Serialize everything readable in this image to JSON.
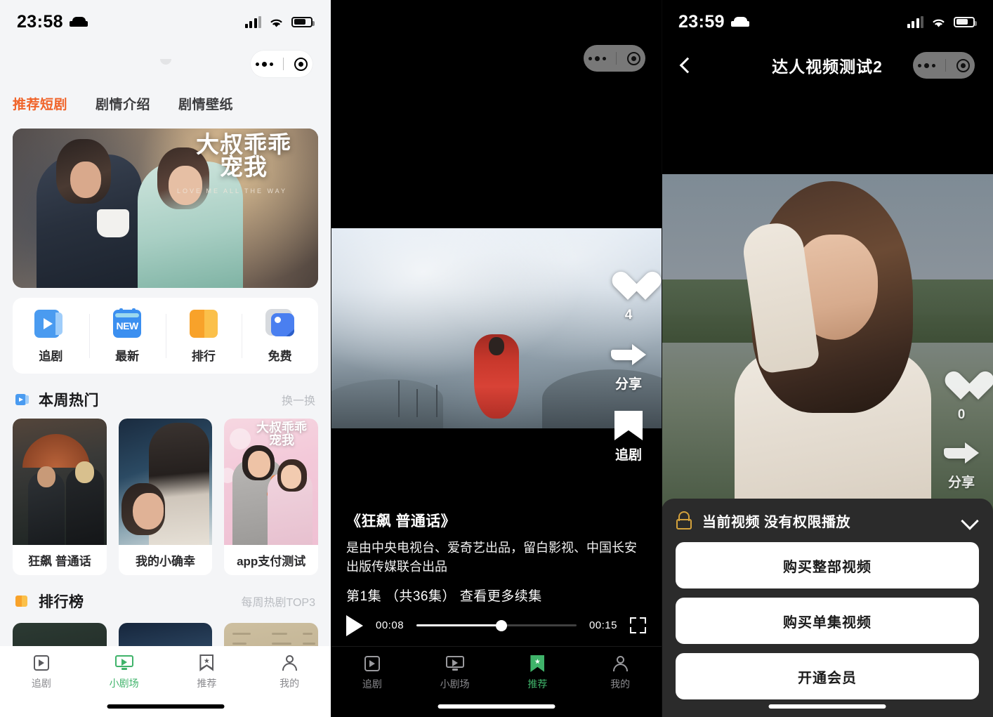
{
  "left": {
    "status": {
      "time": "23:58",
      "bed_icon": "bed-icon",
      "signal_icon": "signal-icon",
      "wifi_icon": "wifi-icon",
      "battery_icon": "battery-icon"
    },
    "capsule": {
      "more_icon": "more-dots-icon",
      "target_icon": "target-circle-icon"
    },
    "tabs": [
      {
        "label": "推荐短剧",
        "active": true
      },
      {
        "label": "剧情介绍",
        "active": false
      },
      {
        "label": "剧情壁纸",
        "active": false
      }
    ],
    "hero": {
      "title_line1": "大叔乖乖",
      "title_line2": "宠我",
      "subtitle": "LOVE ME ALL THE WAY"
    },
    "quick_actions": [
      {
        "label": "追剧",
        "icon": "play-card-icon"
      },
      {
        "label": "最新",
        "icon": "new-calendar-icon",
        "badge": "NEW"
      },
      {
        "label": "排行",
        "icon": "rank-book-icon"
      },
      {
        "label": "免费",
        "icon": "free-image-icon"
      }
    ],
    "hot_section": {
      "title": "本周热门",
      "more": "换一换",
      "icon": "blue-play-icon"
    },
    "hot_cards": [
      {
        "title": "狂飙 普通话"
      },
      {
        "title": "我的小确幸"
      },
      {
        "title": "app支付测试"
      }
    ],
    "rank_section": {
      "title": "排行榜",
      "more": "每周热剧TOP3",
      "icon": "orange-book-icon"
    },
    "tabbar": [
      {
        "label": "追剧",
        "icon": "play-square-icon",
        "active": false
      },
      {
        "label": "小剧场",
        "icon": "tv-icon",
        "active": true
      },
      {
        "label": "推荐",
        "icon": "bookmark-star-icon",
        "active": false
      },
      {
        "label": "我的",
        "icon": "user-icon",
        "active": false
      }
    ]
  },
  "middle": {
    "capsule": {
      "more_icon": "more-dots-icon",
      "target_icon": "target-circle-icon"
    },
    "actions": [
      {
        "name": "like",
        "icon": "heart-icon",
        "label": "4"
      },
      {
        "name": "share",
        "icon": "share-arrow-icon",
        "label": "分享"
      },
      {
        "name": "follow",
        "icon": "bookmark-icon",
        "label": "追剧"
      }
    ],
    "info": {
      "title": "《狂飙 普通话》",
      "desc_line1": "是由中央电视台、爱奇艺出品，留白影视、中国长安",
      "desc_line2": "出版传媒联合出品",
      "episode": "第1集 （共36集） 查看更多续集"
    },
    "player": {
      "play_icon": "play-triangle-icon",
      "current_time": "00:08",
      "total_time": "00:15",
      "progress_percent": 53,
      "fullscreen_icon": "fullscreen-icon"
    },
    "tabbar": [
      {
        "label": "追剧",
        "icon": "play-square-icon",
        "active": false
      },
      {
        "label": "小剧场",
        "icon": "tv-icon",
        "active": false
      },
      {
        "label": "推荐",
        "icon": "bookmark-star-icon",
        "active": true
      },
      {
        "label": "我的",
        "icon": "user-icon",
        "active": false
      }
    ]
  },
  "right": {
    "status": {
      "time": "23:59",
      "bed_icon": "bed-icon",
      "signal_icon": "signal-icon",
      "wifi_icon": "wifi-icon",
      "battery_icon": "battery-icon"
    },
    "nav": {
      "back_icon": "back-chevron-icon",
      "title": "达人视频测试2"
    },
    "capsule": {
      "more_icon": "more-dots-icon",
      "target_icon": "target-circle-icon"
    },
    "actions": [
      {
        "name": "like",
        "icon": "heart-icon",
        "label": "0"
      },
      {
        "name": "share",
        "icon": "share-arrow-icon",
        "label": "分享"
      }
    ],
    "sheet": {
      "lock_icon": "lock-icon",
      "title": "当前视频 没有权限播放",
      "collapse_icon": "chevron-down-icon",
      "buttons": [
        {
          "label": "购买整部视频"
        },
        {
          "label": "购买单集视频"
        },
        {
          "label": "开通会员"
        }
      ]
    }
  },
  "colors": {
    "accent_orange": "#f0642a",
    "accent_green": "#3fb36a",
    "lock_gold": "#d4a23c"
  }
}
